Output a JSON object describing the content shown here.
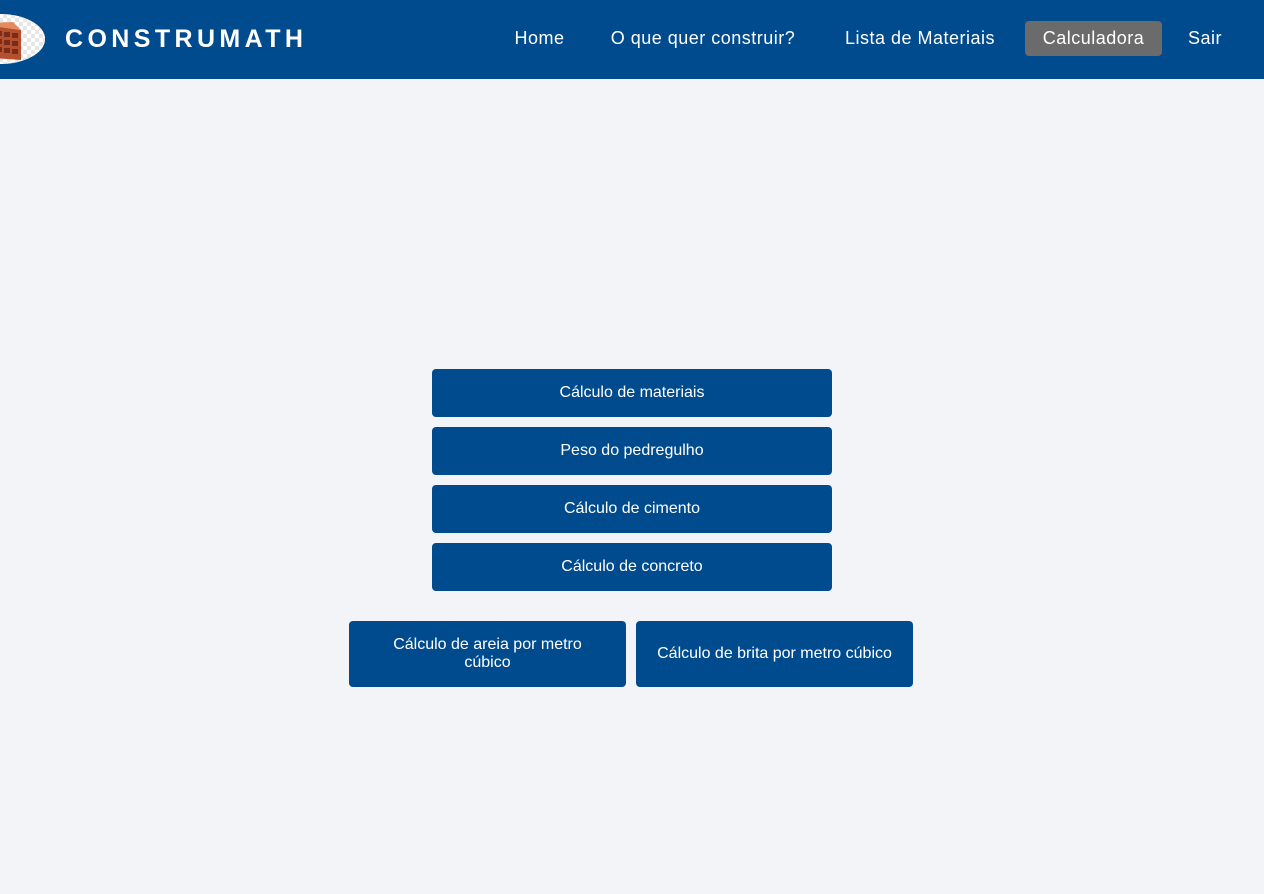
{
  "header": {
    "brand": "CONSTRUMATH",
    "nav": [
      {
        "label": "Home",
        "active": false
      },
      {
        "label": "O que quer construir?",
        "active": false
      },
      {
        "label": "Lista de Materiais",
        "active": false
      },
      {
        "label": "Calculadora",
        "active": true
      },
      {
        "label": "Sair",
        "active": false
      }
    ]
  },
  "calculators": {
    "stacked": [
      "Cálculo de materiais",
      "Peso do pedregulho",
      "Cálculo de cimento",
      "Cálculo de concreto"
    ],
    "row": [
      "Cálculo de areia por metro cúbico",
      "Cálculo de brita por metro cúbico"
    ]
  },
  "colors": {
    "primary": "#004b8d",
    "active_nav": "#6b6b6b",
    "background": "#f3f4f8"
  }
}
